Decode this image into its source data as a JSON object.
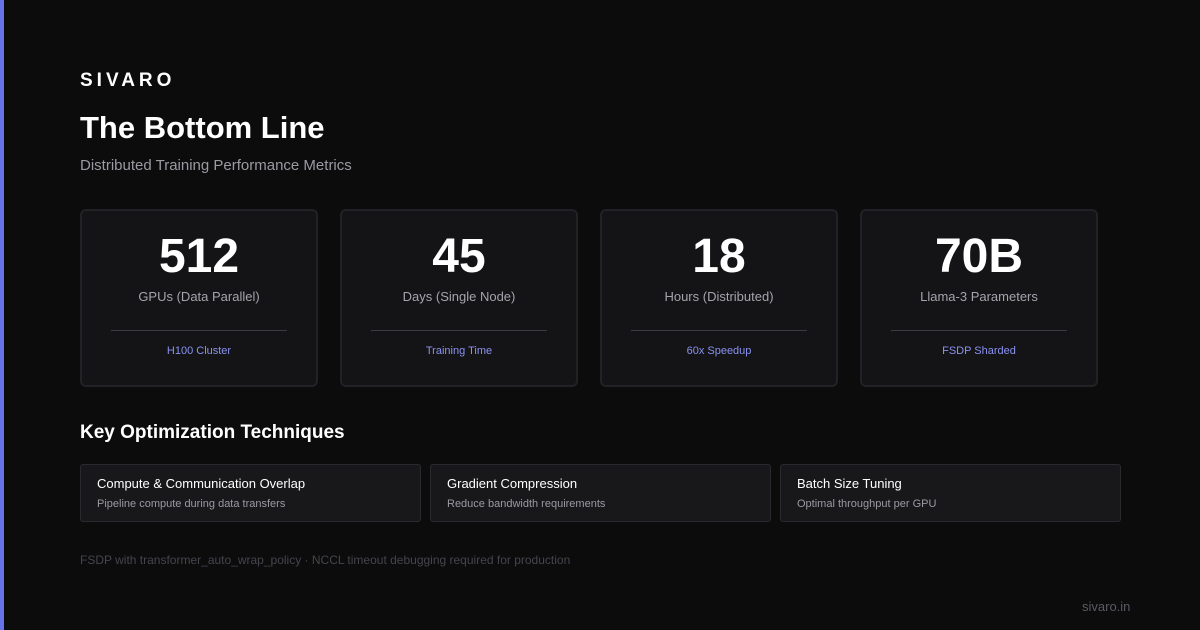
{
  "brand": "SIVARO",
  "title": "The Bottom Line",
  "subtitle": "Distributed Training Performance Metrics",
  "accent_color": "#6672e8",
  "metrics": [
    {
      "value": "512",
      "label": "GPUs (Data Parallel)",
      "tag": "H100 Cluster"
    },
    {
      "value": "45",
      "label": "Days (Single Node)",
      "tag": "Training Time"
    },
    {
      "value": "18",
      "label": "Hours (Distributed)",
      "tag": "60x Speedup"
    },
    {
      "value": "70B",
      "label": "Llama-3 Parameters",
      "tag": "FSDP Sharded"
    }
  ],
  "section_title": "Key Optimization Techniques",
  "techniques": [
    {
      "name": "Compute & Communication Overlap",
      "desc": "Pipeline compute during data transfers"
    },
    {
      "name": "Gradient Compression",
      "desc": "Reduce bandwidth requirements"
    },
    {
      "name": "Batch Size Tuning",
      "desc": "Optimal throughput per GPU"
    }
  ],
  "footnote": "FSDP with transformer_auto_wrap_policy · NCCL timeout debugging required for production",
  "site": "sivaro.in"
}
